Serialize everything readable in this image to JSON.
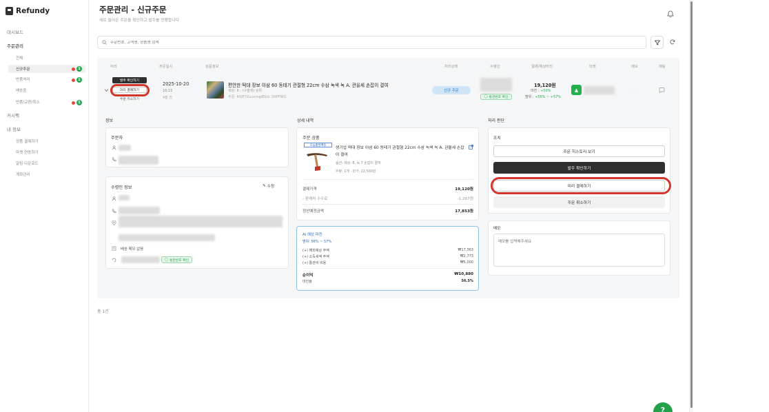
{
  "app": {
    "name": "Refundy"
  },
  "sidebar": {
    "sections": [
      {
        "label": "대시보드"
      },
      {
        "label": "주문관리"
      },
      {
        "label": "커시팩"
      },
      {
        "label": "내 정보"
      }
    ],
    "order_subitems": [
      {
        "label": "전체"
      },
      {
        "label": "신규주문",
        "badge": "1"
      },
      {
        "label": "반품처리",
        "badge": "1"
      },
      {
        "label": "배송중"
      },
      {
        "label": "반품/교환/취소",
        "badge": "1"
      }
    ],
    "info_subitems": [
      {
        "label": "정품 결제하기"
      },
      {
        "label": "마켓 연동하기"
      },
      {
        "label": "알림 다운로드"
      },
      {
        "label": "계좌관리"
      }
    ]
  },
  "header": {
    "title": "주문관리 - 신규주문",
    "subtitle": "새로 들어온 주문을 확인하고 발주를 진행합니다"
  },
  "search": {
    "placeholder": "주문번호, 고객명, 상품명 검색"
  },
  "table": {
    "headers": [
      "처리",
      "주문일시",
      "상품정보",
      "처리상태",
      "수령인",
      "결제/예상마진",
      "마켓",
      "메모",
      "채팅"
    ]
  },
  "order": {
    "action_primary": "발주 확인하기",
    "action_secondary": "미리 결제하기",
    "action_link": "주문 취소하기",
    "date": "2025-10-20",
    "time": "16:15",
    "ago": "4분 전",
    "product_name": "편안한 떡대 장보 이삼 60 동테기 관절형 22cm 수삼 녹색 녹 A. 관을세 손잡이 결여",
    "product_option": "색상: 8 : (구슬색) 상위",
    "product_code": "주문: KVJEYZuuvmgtEGd..5NPFWG",
    "status": "신규 주문",
    "recipient_tag": "통관번호 확인",
    "price": "19,120원",
    "margin_line1": "마진 : +50%",
    "margin_line2": "범위 : +56% ~ +57%",
    "memo": "-",
    "margin_line1_prefix": "마진 : ",
    "margin_line1_value": "+50%",
    "margin_line2_prefix": "범위 : ",
    "margin_line2_value": "+56% ~ +57%"
  },
  "columns": {
    "info": "정보",
    "detail": "상세 내역",
    "actions": "처리 판단"
  },
  "orderer": {
    "title": "주문자"
  },
  "recipient": {
    "title": "수령인 정보",
    "edit_label": "수정",
    "note": "배송 메모 없음",
    "customs_tag": "통관번호 확인"
  },
  "detail": {
    "card_title": "주문 상품",
    "product_tag": "오늘출발배송",
    "product_name": "생기업 떡대 장보 이삼 60 동테기 관절형 22cm 수삼 녹색 녹 A. 관을세 손잡이 결여",
    "product_option": "옵션: 색상: 8, 녹 7 손잡이 결여",
    "product_qty": "수량: 1개 · 단가: 22,500원",
    "rows": [
      {
        "label": "결제가격",
        "value": "19,120원",
        "bold": true
      },
      {
        "label": "- 판매처 수수료",
        "value": "-1,267원",
        "bold": false
      },
      {
        "label": "정산예정금액",
        "value": "17,853원",
        "bold": true
      }
    ]
  },
  "ai": {
    "title": "AI 예상 마진",
    "range": "범위: 56% ~ 57%",
    "rows": [
      {
        "label": "(+) 해외예상 주액",
        "value": "₩17,363"
      },
      {
        "label": "(+) 소득세액 주액",
        "value": "₩2,773"
      },
      {
        "label": "(+) 통관비 비용",
        "value": "₩5,000"
      }
    ],
    "profit_label": "순이익",
    "profit_value": "₩10,880",
    "rate_label": "마진율",
    "rate_value": "56.5%"
  },
  "actions": {
    "group_label": "조치",
    "btn_history": "주문 히스토리 보기",
    "btn_confirm": "발주 확인하기",
    "btn_prepay": "미리 결제하기",
    "btn_cancel": "주문 취소하기"
  },
  "memo": {
    "title": "메모",
    "placeholder": "메모를 입력해주세요"
  },
  "pagination": {
    "text": "총 1건"
  },
  "help": {
    "label": "?"
  },
  "colors": {
    "accent_red": "#d2362b",
    "green": "#29a855",
    "dark": "#2f2f2f",
    "status_blue": "#cfe4f7"
  }
}
